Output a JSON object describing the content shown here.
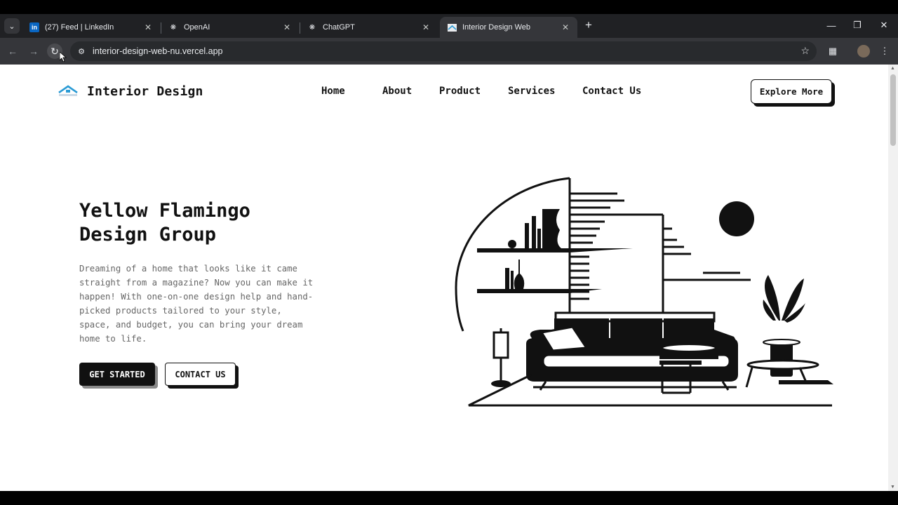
{
  "browser": {
    "tabs": [
      {
        "title": "(27) Feed | LinkedIn",
        "icon": "linkedin-icon"
      },
      {
        "title": "OpenAI",
        "icon": "openai-icon"
      },
      {
        "title": "ChatGPT",
        "icon": "openai-icon"
      },
      {
        "title": "Interior Design Web",
        "icon": "site-favicon",
        "active": true
      }
    ],
    "address": "interior-design-web-nu.vercel.app"
  },
  "header": {
    "brand": "Interior Design",
    "nav": [
      "Home",
      "About",
      "Product",
      "Services",
      "Contact Us"
    ],
    "cta": "Explore More"
  },
  "hero": {
    "title_line1": "Yellow Flamingo",
    "title_line2": "Design Group",
    "description": "Dreaming of a home that looks like it came straight from a magazine? Now you can make it happen! With one-on-one design help and hand-picked products tailored to your style, space, and budget, you can bring your dream home to life.",
    "primary_button": "GET STARTED",
    "secondary_button": "CONTACT US"
  },
  "colors": {
    "ink": "#111111",
    "page_bg": "#ffffff",
    "muted_text": "#666666",
    "logo_accent": "#2a9bd5"
  }
}
